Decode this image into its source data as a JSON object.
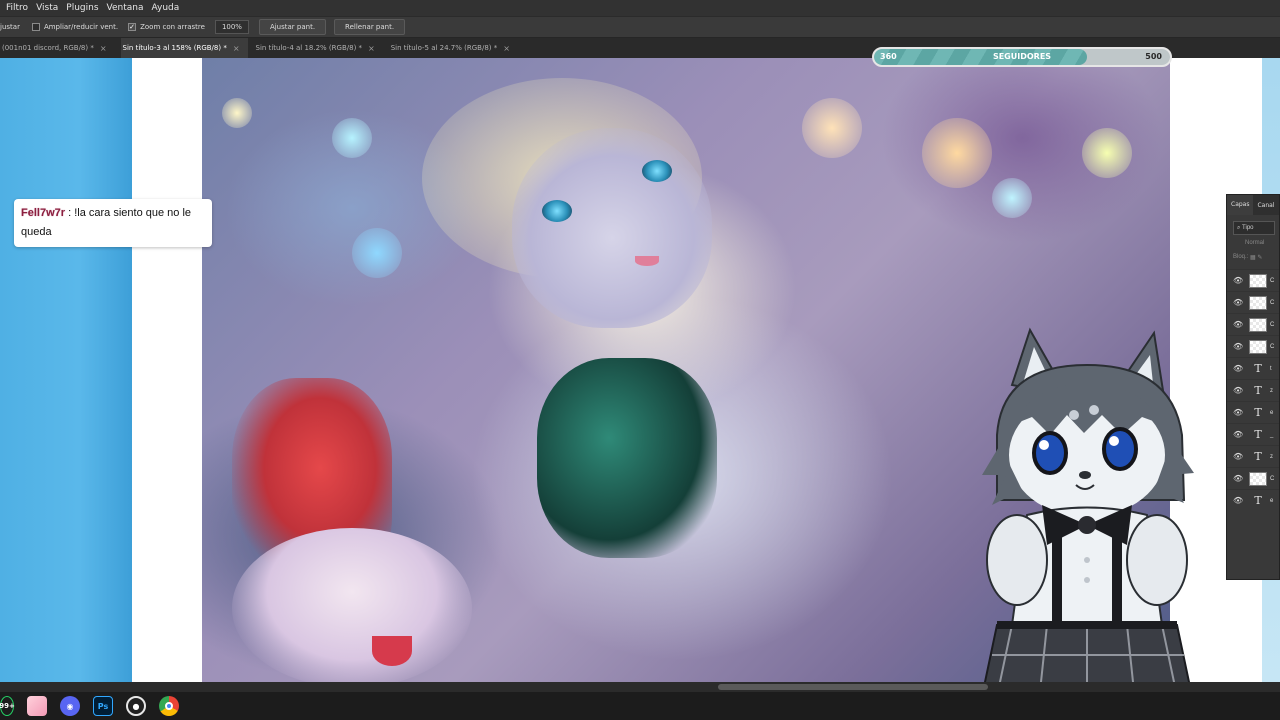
{
  "menubar": {
    "items": [
      "Filtro",
      "Vista",
      "Plugins",
      "Ventana",
      "Ayuda"
    ]
  },
  "options": {
    "ajustar_label": "justar",
    "ampliar_label": "Ampliar/reducir vent.",
    "zoom_drag_label": "Zoom con arrastre",
    "zoom_drag_checked": true,
    "zoom_value": "100%",
    "fit_screen_label": "Ajustar pant.",
    "fill_screen_label": "Rellenar pant."
  },
  "tabs": [
    {
      "label": "(001n01 discord, RGB/8) *",
      "active": false
    },
    {
      "label": "Sin título-3 al 158% (RGB/8) *",
      "active": true
    },
    {
      "label": "Sin título-4 al 18.2% (RGB/8) *",
      "active": false
    },
    {
      "label": "Sin título-5 al 24.7% (RGB/8) *",
      "active": false
    }
  ],
  "tab_close_glyph": "×",
  "followers": {
    "current": "360",
    "label": "SEGUIDORES",
    "goal": "500",
    "progress_fraction": 0.72
  },
  "chat": {
    "username": "Fell7w7r",
    "separator": " : ",
    "message": "!la cara siento que no le queda"
  },
  "layers_panel": {
    "tabs": [
      "Capas",
      "Canal"
    ],
    "search_placeholder": "Tipo",
    "blend_mode": "Normal",
    "lock_label": "Bloq.:",
    "rows": [
      {
        "kind": "thumb",
        "name": "C"
      },
      {
        "kind": "thumb",
        "name": "C"
      },
      {
        "kind": "thumb",
        "name": "C"
      },
      {
        "kind": "thumb",
        "name": "C"
      },
      {
        "kind": "text",
        "name": "t"
      },
      {
        "kind": "text",
        "name": "z"
      },
      {
        "kind": "text",
        "name": "e"
      },
      {
        "kind": "text",
        "name": "_"
      },
      {
        "kind": "text",
        "name": "z"
      },
      {
        "kind": "thumb",
        "name": "C"
      },
      {
        "kind": "text",
        "name": "e"
      }
    ]
  },
  "taskbar": {
    "badge": "99+",
    "apps": [
      "whatsapp-icon",
      "photos-icon",
      "discord-icon",
      "photoshop-icon",
      "obs-icon",
      "chrome-icon"
    ],
    "photoshop_label": "Ps"
  },
  "colors": {
    "accent_teal": "#6fb7b4",
    "chat_username": "#8c1f3f",
    "ps_blue": "#31a8ff"
  }
}
